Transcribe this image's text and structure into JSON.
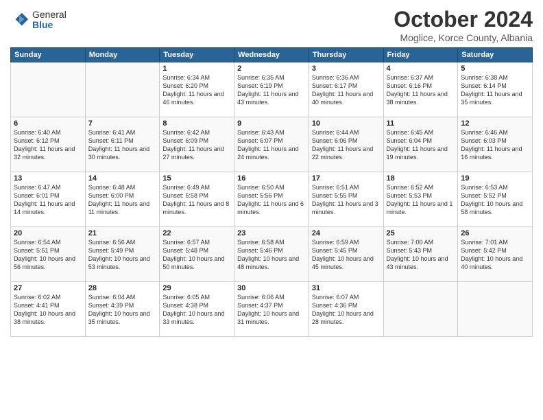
{
  "logo": {
    "general": "General",
    "blue": "Blue"
  },
  "header": {
    "month": "October 2024",
    "location": "Moglice, Korce County, Albania"
  },
  "weekdays": [
    "Sunday",
    "Monday",
    "Tuesday",
    "Wednesday",
    "Thursday",
    "Friday",
    "Saturday"
  ],
  "weeks": [
    [
      {
        "day": "",
        "sunrise": "",
        "sunset": "",
        "daylight": ""
      },
      {
        "day": "",
        "sunrise": "",
        "sunset": "",
        "daylight": ""
      },
      {
        "day": "1",
        "sunrise": "Sunrise: 6:34 AM",
        "sunset": "Sunset: 6:20 PM",
        "daylight": "Daylight: 11 hours and 46 minutes."
      },
      {
        "day": "2",
        "sunrise": "Sunrise: 6:35 AM",
        "sunset": "Sunset: 6:19 PM",
        "daylight": "Daylight: 11 hours and 43 minutes."
      },
      {
        "day": "3",
        "sunrise": "Sunrise: 6:36 AM",
        "sunset": "Sunset: 6:17 PM",
        "daylight": "Daylight: 11 hours and 40 minutes."
      },
      {
        "day": "4",
        "sunrise": "Sunrise: 6:37 AM",
        "sunset": "Sunset: 6:16 PM",
        "daylight": "Daylight: 11 hours and 38 minutes."
      },
      {
        "day": "5",
        "sunrise": "Sunrise: 6:38 AM",
        "sunset": "Sunset: 6:14 PM",
        "daylight": "Daylight: 11 hours and 35 minutes."
      }
    ],
    [
      {
        "day": "6",
        "sunrise": "Sunrise: 6:40 AM",
        "sunset": "Sunset: 6:12 PM",
        "daylight": "Daylight: 11 hours and 32 minutes."
      },
      {
        "day": "7",
        "sunrise": "Sunrise: 6:41 AM",
        "sunset": "Sunset: 6:11 PM",
        "daylight": "Daylight: 11 hours and 30 minutes."
      },
      {
        "day": "8",
        "sunrise": "Sunrise: 6:42 AM",
        "sunset": "Sunset: 6:09 PM",
        "daylight": "Daylight: 11 hours and 27 minutes."
      },
      {
        "day": "9",
        "sunrise": "Sunrise: 6:43 AM",
        "sunset": "Sunset: 6:07 PM",
        "daylight": "Daylight: 11 hours and 24 minutes."
      },
      {
        "day": "10",
        "sunrise": "Sunrise: 6:44 AM",
        "sunset": "Sunset: 6:06 PM",
        "daylight": "Daylight: 11 hours and 22 minutes."
      },
      {
        "day": "11",
        "sunrise": "Sunrise: 6:45 AM",
        "sunset": "Sunset: 6:04 PM",
        "daylight": "Daylight: 11 hours and 19 minutes."
      },
      {
        "day": "12",
        "sunrise": "Sunrise: 6:46 AM",
        "sunset": "Sunset: 6:03 PM",
        "daylight": "Daylight: 11 hours and 16 minutes."
      }
    ],
    [
      {
        "day": "13",
        "sunrise": "Sunrise: 6:47 AM",
        "sunset": "Sunset: 6:01 PM",
        "daylight": "Daylight: 11 hours and 14 minutes."
      },
      {
        "day": "14",
        "sunrise": "Sunrise: 6:48 AM",
        "sunset": "Sunset: 6:00 PM",
        "daylight": "Daylight: 11 hours and 11 minutes."
      },
      {
        "day": "15",
        "sunrise": "Sunrise: 6:49 AM",
        "sunset": "Sunset: 5:58 PM",
        "daylight": "Daylight: 11 hours and 8 minutes."
      },
      {
        "day": "16",
        "sunrise": "Sunrise: 6:50 AM",
        "sunset": "Sunset: 5:56 PM",
        "daylight": "Daylight: 11 hours and 6 minutes."
      },
      {
        "day": "17",
        "sunrise": "Sunrise: 6:51 AM",
        "sunset": "Sunset: 5:55 PM",
        "daylight": "Daylight: 11 hours and 3 minutes."
      },
      {
        "day": "18",
        "sunrise": "Sunrise: 6:52 AM",
        "sunset": "Sunset: 5:53 PM",
        "daylight": "Daylight: 11 hours and 1 minute."
      },
      {
        "day": "19",
        "sunrise": "Sunrise: 6:53 AM",
        "sunset": "Sunset: 5:52 PM",
        "daylight": "Daylight: 10 hours and 58 minutes."
      }
    ],
    [
      {
        "day": "20",
        "sunrise": "Sunrise: 6:54 AM",
        "sunset": "Sunset: 5:51 PM",
        "daylight": "Daylight: 10 hours and 56 minutes."
      },
      {
        "day": "21",
        "sunrise": "Sunrise: 6:56 AM",
        "sunset": "Sunset: 5:49 PM",
        "daylight": "Daylight: 10 hours and 53 minutes."
      },
      {
        "day": "22",
        "sunrise": "Sunrise: 6:57 AM",
        "sunset": "Sunset: 5:48 PM",
        "daylight": "Daylight: 10 hours and 50 minutes."
      },
      {
        "day": "23",
        "sunrise": "Sunrise: 6:58 AM",
        "sunset": "Sunset: 5:46 PM",
        "daylight": "Daylight: 10 hours and 48 minutes."
      },
      {
        "day": "24",
        "sunrise": "Sunrise: 6:59 AM",
        "sunset": "Sunset: 5:45 PM",
        "daylight": "Daylight: 10 hours and 45 minutes."
      },
      {
        "day": "25",
        "sunrise": "Sunrise: 7:00 AM",
        "sunset": "Sunset: 5:43 PM",
        "daylight": "Daylight: 10 hours and 43 minutes."
      },
      {
        "day": "26",
        "sunrise": "Sunrise: 7:01 AM",
        "sunset": "Sunset: 5:42 PM",
        "daylight": "Daylight: 10 hours and 40 minutes."
      }
    ],
    [
      {
        "day": "27",
        "sunrise": "Sunrise: 6:02 AM",
        "sunset": "Sunset: 4:41 PM",
        "daylight": "Daylight: 10 hours and 38 minutes."
      },
      {
        "day": "28",
        "sunrise": "Sunrise: 6:04 AM",
        "sunset": "Sunset: 4:39 PM",
        "daylight": "Daylight: 10 hours and 35 minutes."
      },
      {
        "day": "29",
        "sunrise": "Sunrise: 6:05 AM",
        "sunset": "Sunset: 4:38 PM",
        "daylight": "Daylight: 10 hours and 33 minutes."
      },
      {
        "day": "30",
        "sunrise": "Sunrise: 6:06 AM",
        "sunset": "Sunset: 4:37 PM",
        "daylight": "Daylight: 10 hours and 31 minutes."
      },
      {
        "day": "31",
        "sunrise": "Sunrise: 6:07 AM",
        "sunset": "Sunset: 4:36 PM",
        "daylight": "Daylight: 10 hours and 28 minutes."
      },
      {
        "day": "",
        "sunrise": "",
        "sunset": "",
        "daylight": ""
      },
      {
        "day": "",
        "sunrise": "",
        "sunset": "",
        "daylight": ""
      }
    ]
  ]
}
